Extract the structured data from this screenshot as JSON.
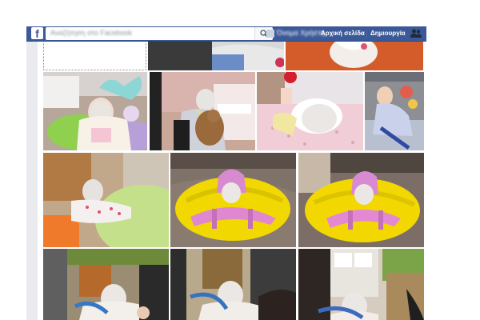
{
  "topbar": {
    "logo_glyph": "f",
    "search_placeholder": "Αναζήτηση στο Facebook",
    "profile_name": "Όνομα Χρήστη",
    "home_label": "Αρχική σελίδα",
    "create_label": "Δημιουργία",
    "icons": [
      "facebook-logo",
      "search-icon",
      "friends-icon"
    ]
  },
  "photos": {
    "count": 13,
    "colors": {
      "facebook_blue": "#3b5998",
      "page_bg": "#e9ebee"
    }
  }
}
